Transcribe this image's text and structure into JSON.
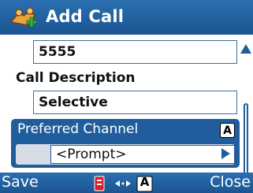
{
  "header": {
    "title": "Add Call",
    "icon": "add-call-icon"
  },
  "form": {
    "number_value": "5555",
    "call_description_label": "Call Description",
    "call_description_value": "Selective",
    "preferred_channel_label": "Preferred Channel",
    "preferred_channel_badge": "A",
    "preferred_channel_value": "<Prompt>"
  },
  "softkeys": {
    "left": "Save",
    "right": "Close",
    "status_badge": "A"
  },
  "colors": {
    "accent": "#1f5d9c",
    "titlebar": "#2a6fb0",
    "alert": "#d8202a"
  }
}
